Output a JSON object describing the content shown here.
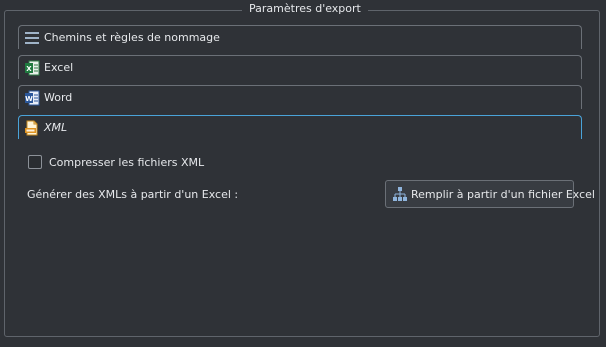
{
  "groupbox": {
    "title": "Paramètres d'export"
  },
  "accordion": {
    "items": [
      {
        "label": "Chemins et règles de nommage",
        "icon": "list-icon"
      },
      {
        "label": "Excel",
        "icon": "excel-icon"
      },
      {
        "label": "Word",
        "icon": "word-icon"
      },
      {
        "label": "XML",
        "icon": "xml-file-icon"
      }
    ]
  },
  "xml_panel": {
    "compress_label": "Compresser les fichiers XML",
    "compress_checked": false,
    "generate_label": "Générer des XMLs à partir d'un Excel :",
    "fill_button_label": "Remplir à partir d'un fichier Excel",
    "fill_button_icon": "hierarchy-icon"
  },
  "colors": {
    "background": "#2f3237",
    "active_border": "#4aa3d9"
  }
}
